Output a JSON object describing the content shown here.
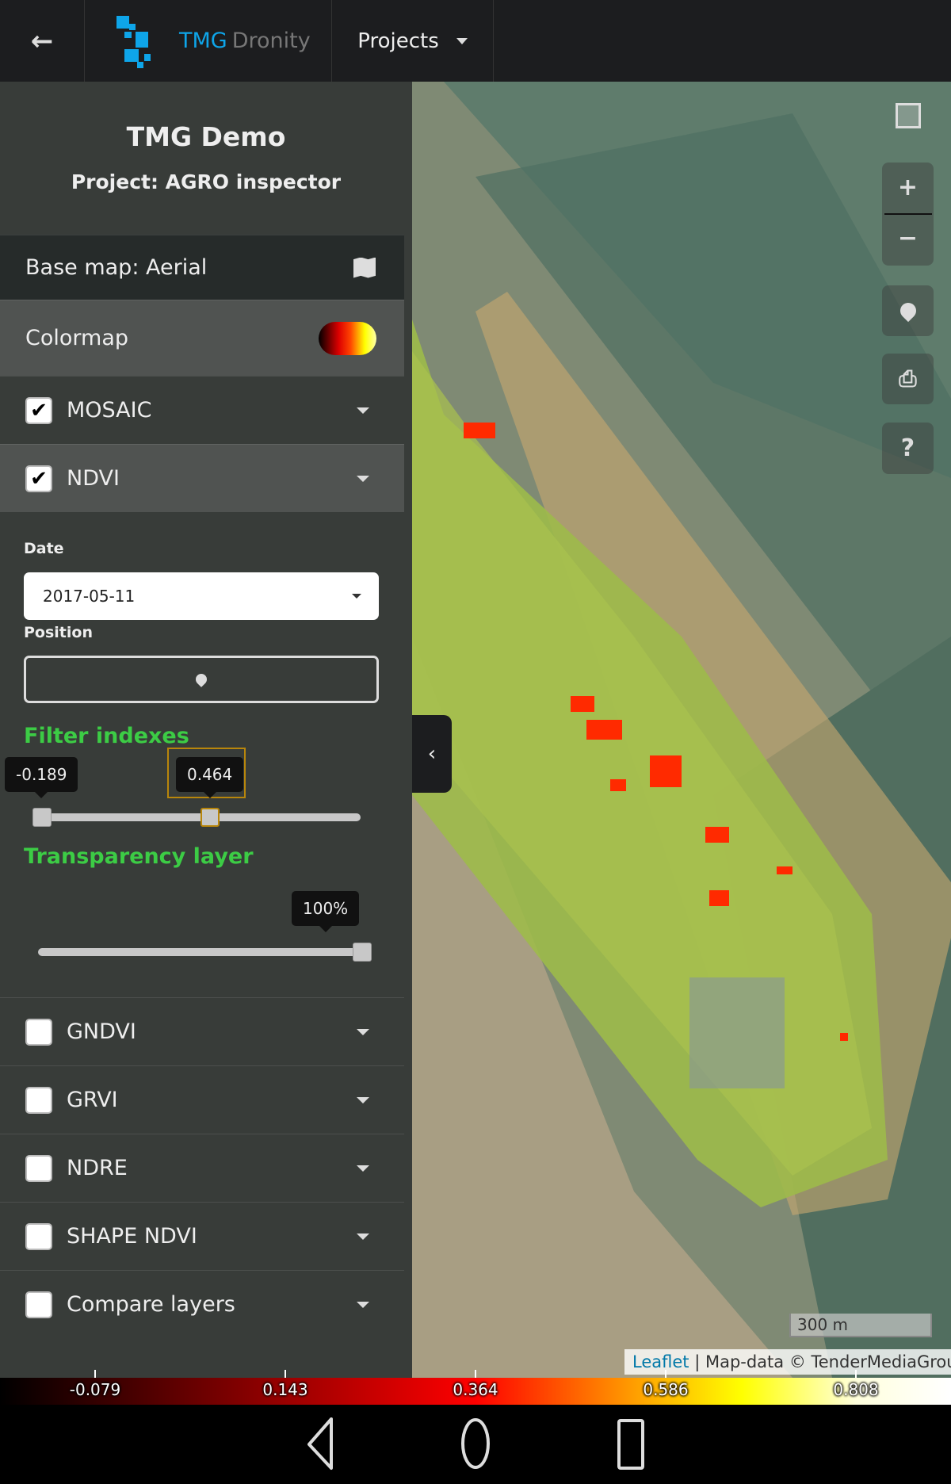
{
  "header": {
    "brand_tmg": "TMG",
    "brand_dronity": "Dronity",
    "projects_label": "Projects",
    "brand_color": "#0ea5e9"
  },
  "sidebar": {
    "title": "TMG Demo",
    "subtitle": "Project: AGRO inspector",
    "basemap_label": "Base map: Aerial",
    "colormap_label": "Colormap",
    "layers_top": [
      {
        "label": "MOSAIC",
        "checked": true
      },
      {
        "label": "NDVI",
        "checked": true
      }
    ],
    "ndvi": {
      "date_label": "Date",
      "date_value": "2017-05-11",
      "position_label": "Position",
      "filter_label": "Filter indexes",
      "filter_min": "-0.189",
      "filter_max": "0.464",
      "transparency_label": "Transparency layer",
      "transparency_value": "100%"
    },
    "layers_bottom": [
      {
        "label": "GNDVI",
        "checked": false
      },
      {
        "label": "GRVI",
        "checked": false
      },
      {
        "label": "NDRE",
        "checked": false
      },
      {
        "label": "SHAPE NDVI",
        "checked": false
      },
      {
        "label": "Compare layers",
        "checked": false
      }
    ]
  },
  "map": {
    "scale": "300 m",
    "attribution_link": "Leaflet",
    "attribution_text": "| Map-data © TenderMediaGroup"
  },
  "colorbar": {
    "ticks": [
      "-0.079",
      "0.143",
      "0.364",
      "0.586",
      "0.808"
    ]
  },
  "accent_green": "#3ccc45"
}
